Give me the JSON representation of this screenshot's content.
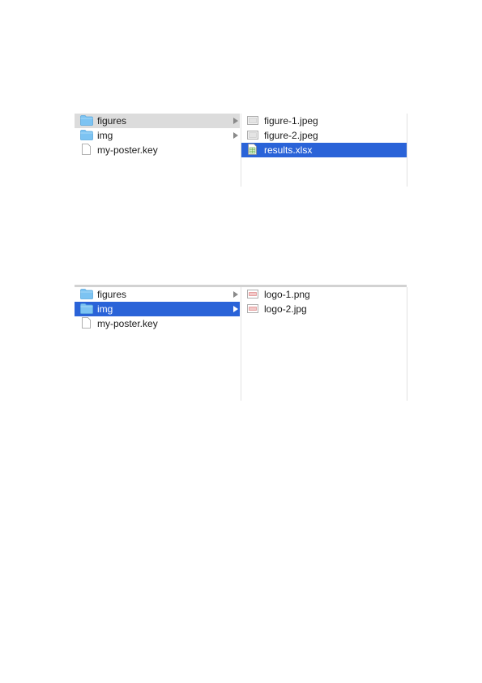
{
  "browser_top": {
    "left_column": [
      {
        "name": "figures",
        "icon": "folder-icon",
        "has_children": true,
        "state": "selected-inactive"
      },
      {
        "name": "img",
        "icon": "folder-icon",
        "has_children": true,
        "state": "none"
      },
      {
        "name": "my-poster.key",
        "icon": "document-icon",
        "has_children": false,
        "state": "none"
      }
    ],
    "right_column": [
      {
        "name": "figure-1.jpeg",
        "icon": "image-file-icon",
        "state": "none"
      },
      {
        "name": "figure-2.jpeg",
        "icon": "image-file-icon",
        "state": "none"
      },
      {
        "name": "results.xlsx",
        "icon": "spreadsheet-icon",
        "state": "selected"
      }
    ]
  },
  "browser_bottom": {
    "left_column": [
      {
        "name": "figures",
        "icon": "folder-icon",
        "has_children": true,
        "state": "none"
      },
      {
        "name": "img",
        "icon": "folder-icon",
        "has_children": true,
        "state": "selected"
      },
      {
        "name": "my-poster.key",
        "icon": "document-icon",
        "has_children": false,
        "state": "none"
      }
    ],
    "right_column": [
      {
        "name": "logo-1.png",
        "icon": "image-file-icon",
        "state": "none"
      },
      {
        "name": "logo-2.jpg",
        "icon": "image-file-icon",
        "state": "none"
      }
    ]
  },
  "colors": {
    "selection_blue": "#2a63d8",
    "selection_gray": "#dcdcdc",
    "folder_blue": "#7cc3f2"
  }
}
